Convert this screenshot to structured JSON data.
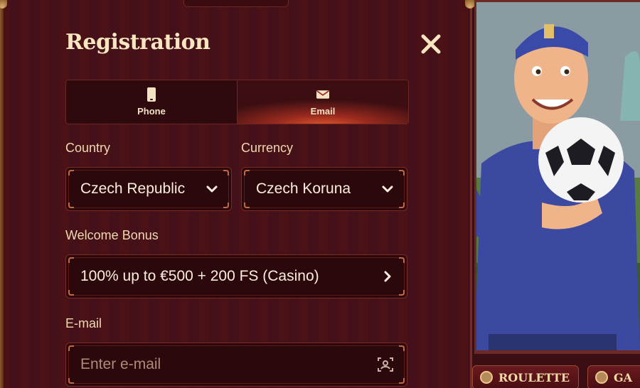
{
  "modal": {
    "title": "Registration",
    "tabs": [
      {
        "label": "Phone",
        "icon": "phone-icon",
        "active": false
      },
      {
        "label": "Email",
        "icon": "envelope-icon",
        "active": true
      }
    ],
    "country": {
      "label": "Country",
      "value": "Czech Republic"
    },
    "currency": {
      "label": "Currency",
      "value": "Czech Koruna"
    },
    "bonus": {
      "label": "Welcome Bonus",
      "value": "100% up to €500 + 200 FS (Casino)"
    },
    "email": {
      "label": "E-mail",
      "placeholder": "Enter e-mail"
    }
  },
  "game_nav": {
    "roulette": "ROULETTE",
    "games": "GA"
  },
  "colors": {
    "panel_bg": "#4a1217",
    "accent": "#e0582a",
    "text_light": "#f8e6c0"
  }
}
